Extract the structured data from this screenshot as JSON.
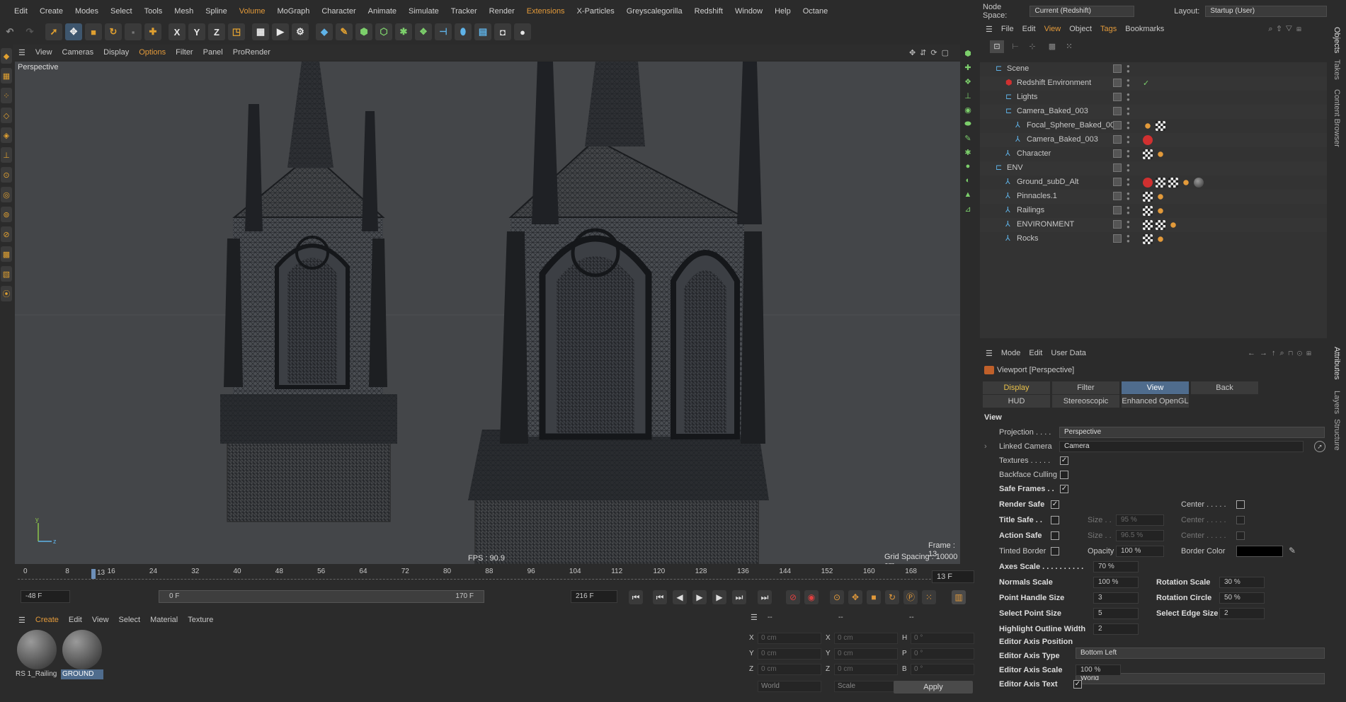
{
  "menubar": [
    "Edit",
    "Create",
    "Modes",
    "Select",
    "Tools",
    "Mesh",
    "Spline",
    "Volume",
    "MoGraph",
    "Character",
    "Animate",
    "Simulate",
    "Tracker",
    "Render",
    "Extensions",
    "X-Particles",
    "Greyscalegorilla",
    "Redshift",
    "Window",
    "Help",
    "Octane"
  ],
  "menubar_highlight": [
    "Volume",
    "Extensions"
  ],
  "toolbar": {
    "axis_x": "X",
    "axis_y": "Y",
    "axis_z": "Z"
  },
  "viewport_menu": {
    "view": "View",
    "cameras": "Cameras",
    "display": "Display",
    "options": "Options",
    "filter": "Filter",
    "panel": "Panel",
    "prorender": "ProRender"
  },
  "viewport": {
    "label": "Perspective",
    "fps": "FPS : 90.9",
    "frame": "Frame : 13",
    "grid": "Grid Spacing : 10000 cm"
  },
  "timeline": {
    "ticks": [
      "0",
      "8",
      "16",
      "24",
      "32",
      "40",
      "48",
      "56",
      "64",
      "72",
      "80",
      "88",
      "96",
      "104",
      "112",
      "120",
      "128",
      "136",
      "144",
      "152",
      "160",
      "168"
    ],
    "marker": "13",
    "current_frame": "13 F"
  },
  "playbar": {
    "start": "-48 F",
    "range_start": "0 F",
    "range_end": "170 F",
    "end": "216 F"
  },
  "material_menu": {
    "create": "Create",
    "edit": "Edit",
    "view": "View",
    "select": "Select",
    "material": "Material",
    "texture": "Texture"
  },
  "materials": [
    {
      "name": "RS 1_Railing"
    },
    {
      "name": "GROUND"
    }
  ],
  "coords": {
    "header": [
      "--",
      "--",
      "--"
    ],
    "rows": [
      {
        "a": "X",
        "av": "0 cm",
        "b": "X",
        "bv": "0 cm",
        "c": "H",
        "cv": "0 °"
      },
      {
        "a": "Y",
        "av": "0 cm",
        "b": "Y",
        "bv": "0 cm",
        "c": "P",
        "cv": "0 °"
      },
      {
        "a": "Z",
        "av": "0 cm",
        "b": "Z",
        "bv": "0 cm",
        "c": "B",
        "cv": "0 °"
      }
    ],
    "world": "World",
    "scale": "Scale",
    "apply": "Apply"
  },
  "nodespace": {
    "label": "Node Space:",
    "value": "Current (Redshift)",
    "layout_label": "Layout:",
    "layout_value": "Startup (User)"
  },
  "object_menu": {
    "file": "File",
    "edit": "Edit",
    "view": "View",
    "object": "Object",
    "tags": "Tags",
    "bookmarks": "Bookmarks"
  },
  "objects": [
    {
      "name": "Scene",
      "depth": 0,
      "tags": []
    },
    {
      "name": "Redshift Environment",
      "depth": 1,
      "tags": []
    },
    {
      "name": "Lights",
      "depth": 1,
      "tags": []
    },
    {
      "name": "Camera_Baked_003",
      "depth": 1,
      "tags": []
    },
    {
      "name": "Focal_Sphere_Baked_003",
      "depth": 2,
      "tags": [
        "org",
        "chk"
      ]
    },
    {
      "name": "Camera_Baked_003",
      "depth": 2,
      "tags": [
        "red"
      ]
    },
    {
      "name": "Character",
      "depth": 1,
      "tags": [
        "chk",
        "org"
      ]
    },
    {
      "name": "ENV",
      "depth": 0,
      "tags": []
    },
    {
      "name": "Ground_subD_Alt",
      "depth": 1,
      "tags": [
        "red",
        "chk",
        "chk",
        "org",
        "gry"
      ]
    },
    {
      "name": "Pinnacles.1",
      "depth": 1,
      "tags": [
        "chk",
        "org"
      ]
    },
    {
      "name": "Railings",
      "depth": 1,
      "tags": [
        "chk",
        "org"
      ]
    },
    {
      "name": "ENVIRONMENT",
      "depth": 1,
      "tags": [
        "chk",
        "chk",
        "org"
      ]
    },
    {
      "name": "Rocks",
      "depth": 1,
      "tags": [
        "chk",
        "org"
      ]
    }
  ],
  "attr_menu": {
    "mode": "Mode",
    "edit": "Edit",
    "userdata": "User Data"
  },
  "attr_title": "Viewport [Perspective]",
  "attr_tabs": {
    "display": "Display",
    "filter": "Filter",
    "view": "View",
    "back": "Back",
    "hud": "HUD",
    "stereo": "Stereoscopic",
    "opengl": "Enhanced OpenGL"
  },
  "attr": {
    "section": "View",
    "projection_label": "Projection . . . .",
    "projection": "Perspective",
    "linked_label": "Linked Camera",
    "linked": "Camera",
    "textures_label": "Textures . . . . .",
    "backface_label": "Backface Culling",
    "safeframes_label": "Safe Frames . .",
    "rendersafe_label": "Render Safe",
    "titlesafe_label": "Title Safe . .",
    "actionsafe_label": "Action Safe",
    "tinted_label": "Tinted Border",
    "center_label": "Center . . . . .",
    "size_label": "Size . .",
    "size_title": "95 %",
    "size_action": "96.5 %",
    "opacity_label": "Opacity",
    "opacity": "100 %",
    "bordercolor_label": "Border Color",
    "axesscale_label": "Axes Scale . . . . . . . . . .",
    "axesscale": "70 %",
    "normals_label": "Normals Scale",
    "normals": "100 %",
    "rotscale_label": "Rotation Scale",
    "rotscale": "30 %",
    "pointhandle_label": "Point Handle Size",
    "pointhandle": "3",
    "rotcircle_label": "Rotation Circle",
    "rotcircle": "50 %",
    "selpoint_label": "Select Point Size",
    "selpoint": "5",
    "seledge_label": "Select Edge Size",
    "seledge": "2",
    "highlight_label": "Highlight Outline Width",
    "highlight": "2",
    "axispos_label": "Editor Axis Position",
    "axispos": "Bottom Left",
    "axistype_label": "Editor Axis Type",
    "axistype": "World",
    "axisscale_label": "Editor Axis Scale",
    "axisscale": "100 %",
    "axistext_label": "Editor Axis Text"
  },
  "side_tabs": {
    "objects": "Objects",
    "takes": "Takes",
    "content": "Content Browser",
    "attributes": "Attributes",
    "layers": "Layers",
    "structure": "Structure"
  },
  "colors": {
    "accent": "#e39a3a",
    "selection": "#4f6c8d",
    "bg": "#2b2b2b",
    "viewport": "#444649"
  }
}
